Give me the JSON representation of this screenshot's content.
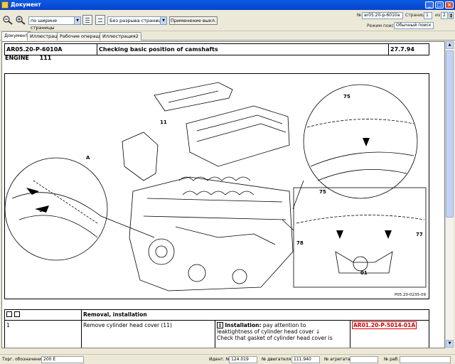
{
  "window": {
    "title": "Документ"
  },
  "toolbar": {
    "zoom_select": "по ширине страницы",
    "break_select": "Без разрыва страниц",
    "apply_button": "Применение выкл.",
    "doc_no_label": "№",
    "doc_no_value": "ar05.20-p-6010a",
    "page_label": "Страница",
    "page_value": "1",
    "page_of_label": "из",
    "page_total": "2",
    "search_mode_label": "Режим поиска",
    "search_mode_value": "Обычный поиск"
  },
  "tabs": [
    {
      "label": "Документ",
      "active": true
    },
    {
      "label": "Иллюстрация",
      "active": false
    },
    {
      "label": "Рабочие операции",
      "active": false
    },
    {
      "label": "Иллюстрация2",
      "active": false
    }
  ],
  "document": {
    "code": "AR05.20-P-6010A",
    "title": "Checking basic position of camshafts",
    "date": "27.7.94",
    "engine_label": "ENGINE",
    "engine_value": "111",
    "figure_ref": "P05.20-0235-09",
    "figure_callouts": [
      "75",
      "11",
      "A",
      "95",
      "75",
      "78",
      "77",
      "01"
    ],
    "steps_header": "Removal, installation",
    "steps": [
      {
        "num": "1",
        "action": "Remove cylinder head cover (11)",
        "note_bold": "Installation:",
        "note_line1": "pay attention to",
        "note_line2": "leaktightness of cylinder head cover",
        "note_line3": "Check that gasket of cylinder head cover is",
        "ref": "AR01.20-P-5014-01A"
      }
    ]
  },
  "statusbar": {
    "model_label": "Торг. обозначение",
    "model_value": "200 E",
    "ident_label": "Идент. №",
    "ident_value": "124.019",
    "engine_label": "№ двигателя",
    "engine_value": "111.940",
    "unit_label": "№ агрегата",
    "unit_value": "",
    "work_label": "№ раб.",
    "work_value": ""
  },
  "colors": {
    "titlebar": "#0a5ae6",
    "reference_red": "#d40000"
  }
}
